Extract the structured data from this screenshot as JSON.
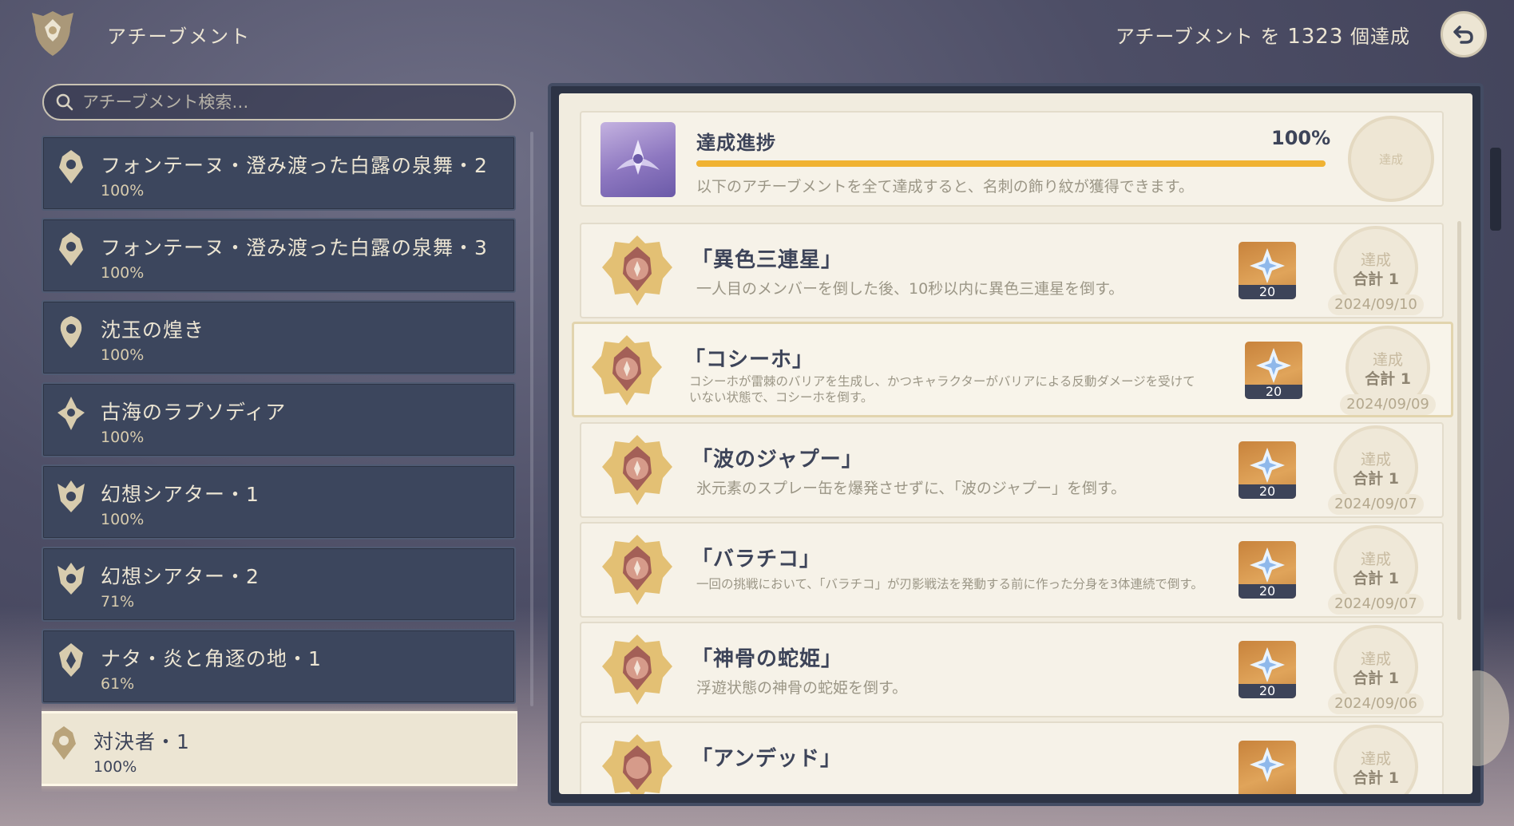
{
  "header": {
    "title": "アチーブメント",
    "count_prefix": "アチーブメント を",
    "count_value": "1323",
    "count_suffix": "個達成",
    "back_icon": "back-arrow-icon"
  },
  "search": {
    "placeholder": "アチーブメント検索…",
    "value": ""
  },
  "categories": [
    {
      "name": "フォンテーヌ・澄み渡った白露の泉舞・2",
      "percent": "100%",
      "selected": false
    },
    {
      "name": "フォンテーヌ・澄み渡った白露の泉舞・3",
      "percent": "100%",
      "selected": false
    },
    {
      "name": "沈玉の煌き",
      "percent": "100%",
      "selected": false
    },
    {
      "name": "古海のラプソディア",
      "percent": "100%",
      "selected": false
    },
    {
      "name": "幻想シアター・1",
      "percent": "100%",
      "selected": false
    },
    {
      "name": "幻想シアター・2",
      "percent": "71%",
      "selected": false
    },
    {
      "name": "ナタ・炎と角逐の地・1",
      "percent": "61%",
      "selected": false
    },
    {
      "name": "対決者・1",
      "percent": "100%",
      "selected": true
    }
  ],
  "progress": {
    "title": "達成進捗",
    "percent_label": "100%",
    "percent_value": 100,
    "description": "以下のアチーブメントを全て達成すると、名刺の飾り紋が獲得できます。",
    "seal": "達成"
  },
  "achievements": [
    {
      "name": "「異色三連星」",
      "description": "一人目のメンバーを倒した後、10秒以内に異色三連星を倒す。",
      "reward_qty": "20",
      "status": "達成",
      "total": "合計 1",
      "date": "2024/09/10"
    },
    {
      "name": "「コシーホ」",
      "description_line1": "コシーホが雷棘のバリアを生成し、かつキャラクターがバリアによる反動ダメージを受けて",
      "description_line2": "いない状態で、コシーホを倒す。",
      "reward_qty": "20",
      "status": "達成",
      "total": "合計 1",
      "date": "2024/09/09"
    },
    {
      "name": "「波のジャプー」",
      "description": "氷元素のスプレー缶を爆発させずに、「波のジャプー」を倒す。",
      "reward_qty": "20",
      "status": "達成",
      "total": "合計 1",
      "date": "2024/09/07"
    },
    {
      "name": "「バラチコ」",
      "description": "一回の挑戦において、「バラチコ」が刃影戦法を発動する前に作った分身を3体連続で倒す。",
      "reward_qty": "20",
      "status": "達成",
      "total": "合計 1",
      "date": "2024/09/07"
    },
    {
      "name": "「神骨の蛇姫」",
      "description": "浮遊状態の神骨の蛇姫を倒す。",
      "reward_qty": "20",
      "status": "達成",
      "total": "合計 1",
      "date": "2024/09/06"
    },
    {
      "name": "「アンデッド」",
      "reward_qty": "",
      "status": "達成",
      "total": "合計 1",
      "date": ""
    }
  ]
}
